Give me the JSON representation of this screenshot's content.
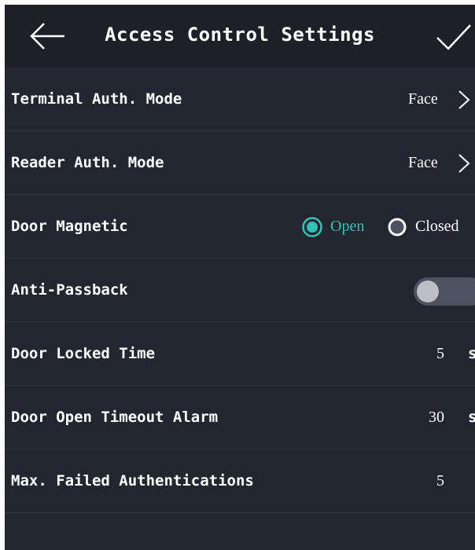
{
  "header": {
    "title": "Access Control Settings",
    "back_icon": "arrow-left-icon",
    "confirm_icon": "checkmark-icon"
  },
  "settings": {
    "terminal_auth_mode": {
      "label": "Terminal Auth. Mode",
      "value": "Face"
    },
    "reader_auth_mode": {
      "label": "Reader Auth. Mode",
      "value": "Face"
    },
    "door_magnetic": {
      "label": "Door Magnetic",
      "options": [
        "Open",
        "Closed"
      ],
      "selected": "Open"
    },
    "anti_passback": {
      "label": "Anti-Passback",
      "enabled": false
    },
    "door_locked_time": {
      "label": "Door Locked Time",
      "value": "5",
      "unit": "s"
    },
    "door_open_timeout_alarm": {
      "label": "Door Open Timeout Alarm",
      "value": "30",
      "unit": "s"
    },
    "max_failed_authentications": {
      "label": "Max. Failed Authentications",
      "value": "5"
    }
  },
  "colors": {
    "background": "#212630",
    "header": "#1d2027",
    "accent": "#2ec4b6",
    "text": "#ffffff",
    "divider": "#343a45"
  }
}
